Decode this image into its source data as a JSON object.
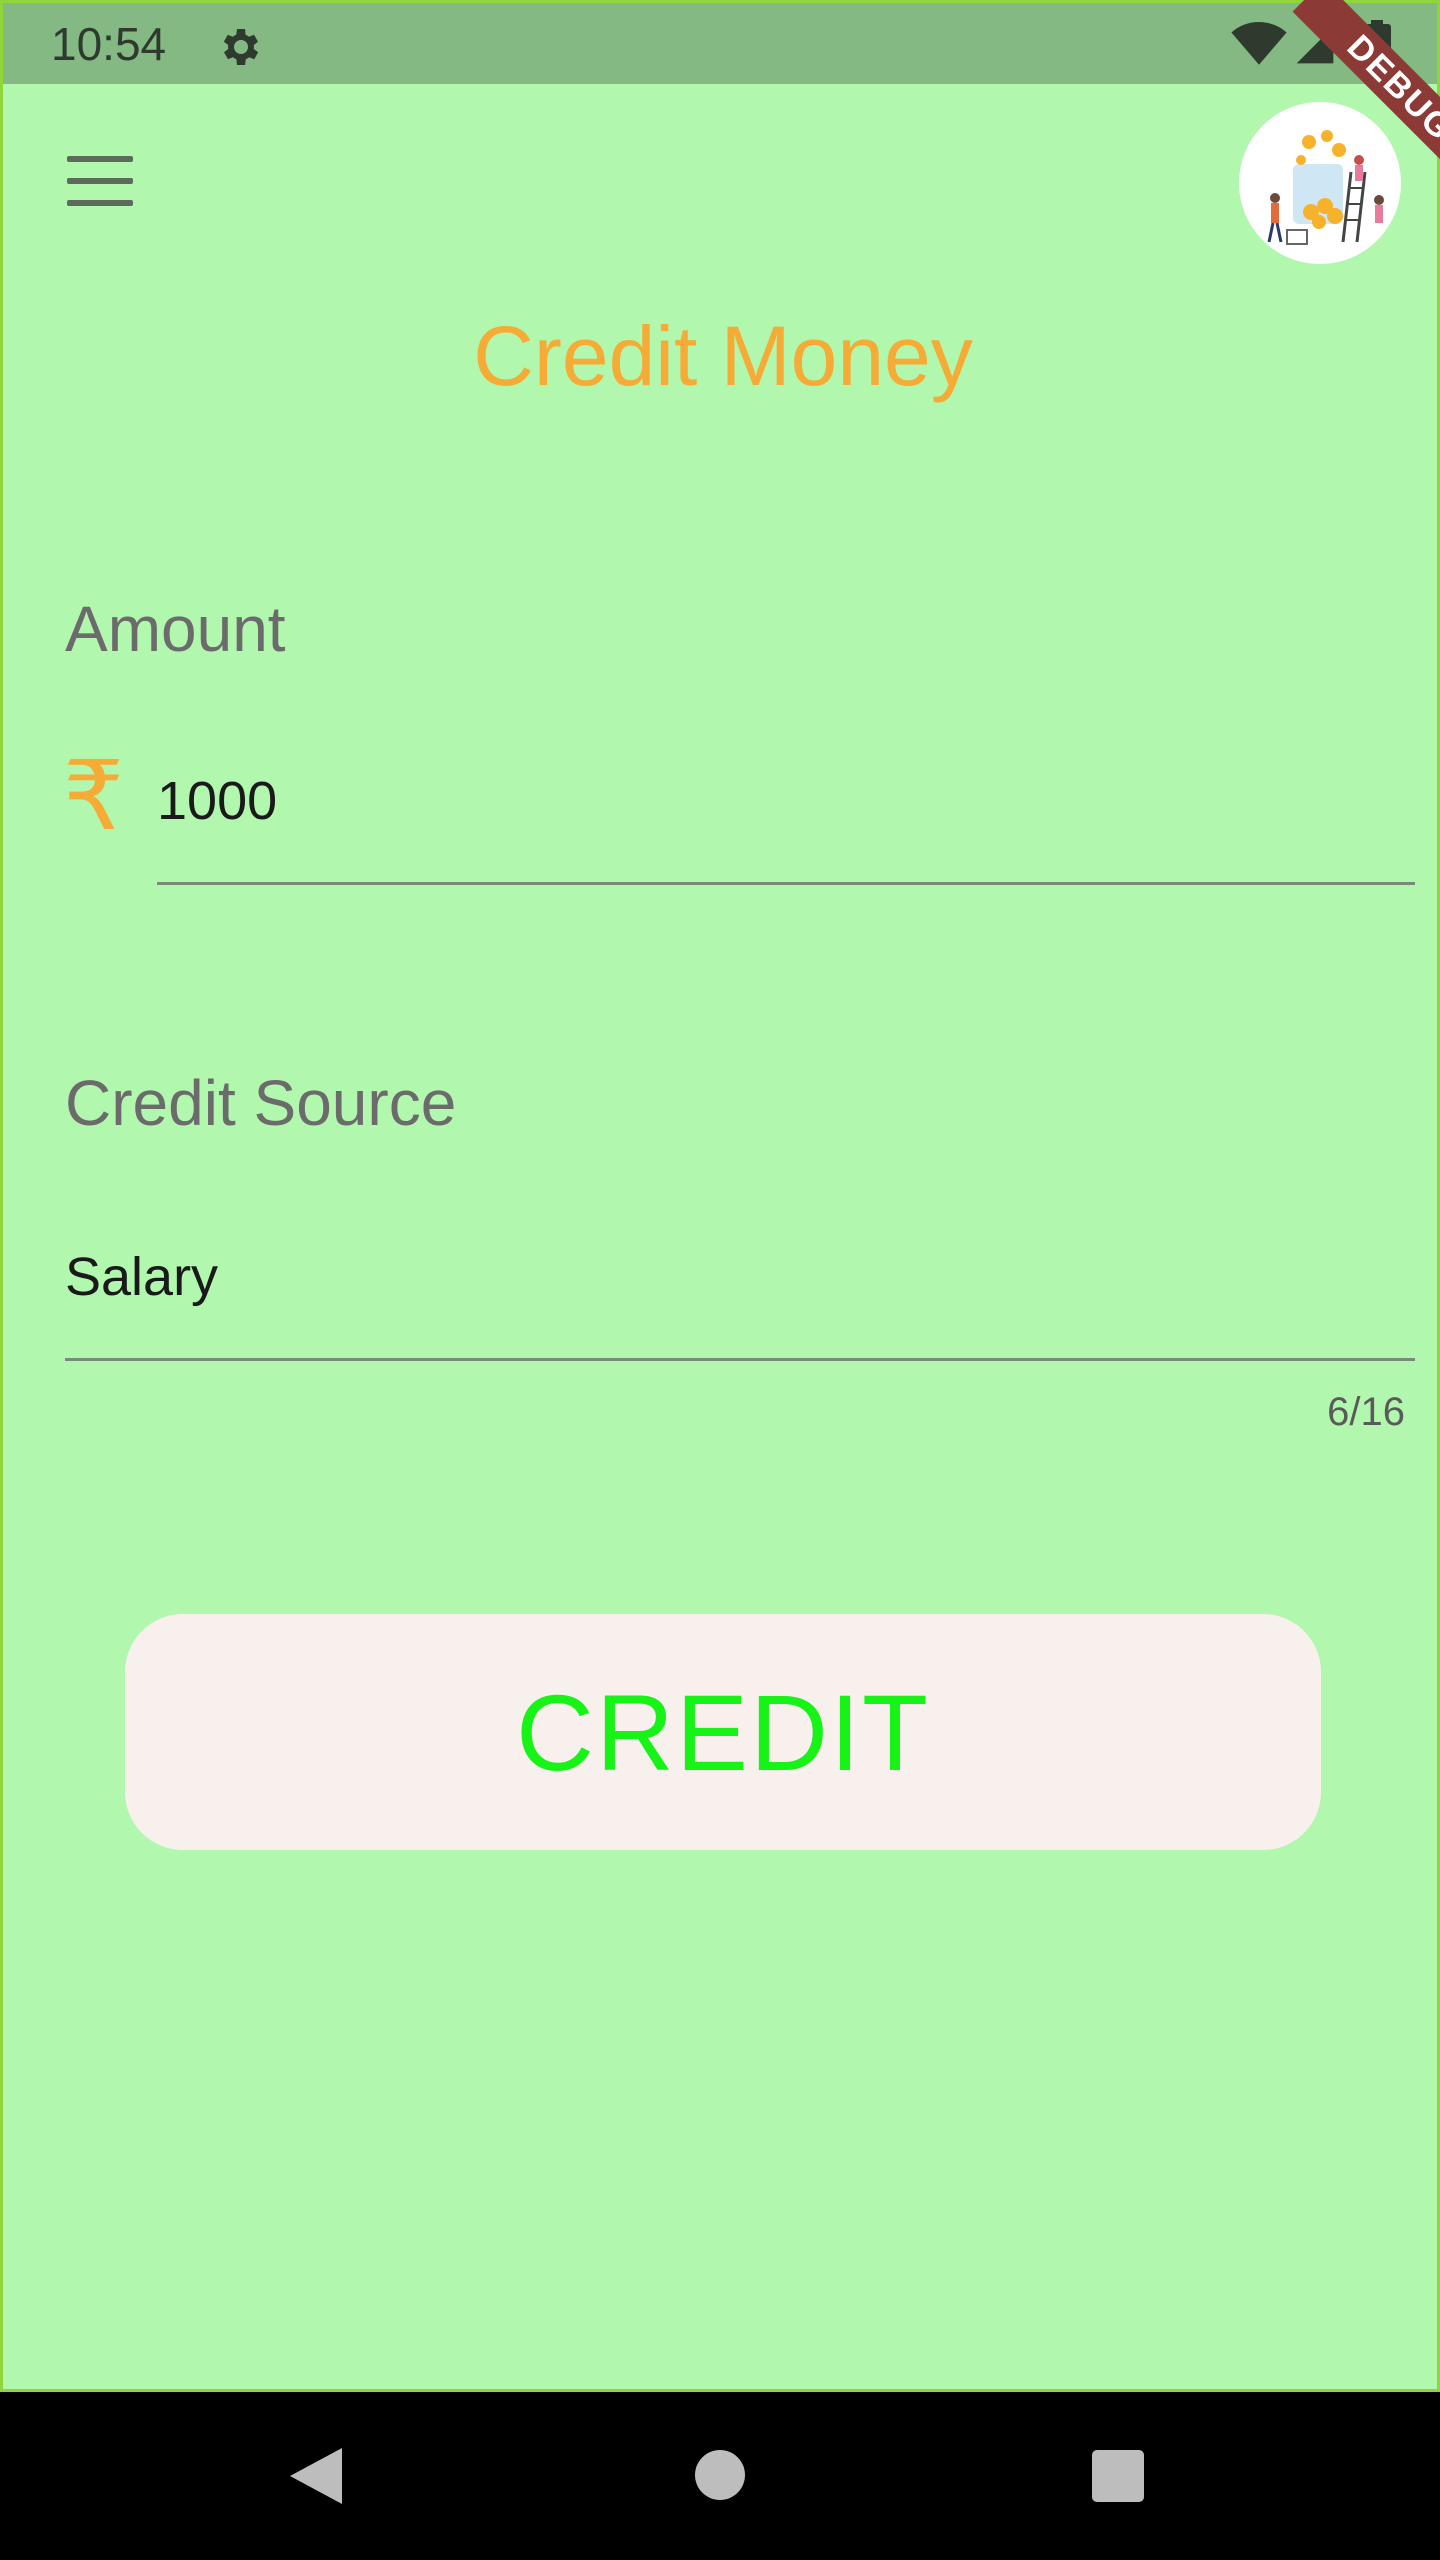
{
  "status_bar": {
    "time": "10:54",
    "icons": [
      "gear-icon",
      "wifi-icon",
      "signal-icon",
      "battery-icon"
    ]
  },
  "debug_banner": "DEBUG",
  "header": {
    "menu_icon": "menu-icon",
    "avatar": "avatar-illustration"
  },
  "page": {
    "title": "Credit Money"
  },
  "amount": {
    "label": "Amount",
    "currency_symbol": "₹",
    "value": "1000"
  },
  "credit_source": {
    "label": "Credit Source",
    "value": "Salary",
    "counter": "6/16"
  },
  "actions": {
    "credit_label": "CREDIT"
  },
  "colors": {
    "background": "#b2f7ae",
    "accent": "#f5ab35",
    "button_text": "#17f217",
    "button_bg": "#f8f0ed"
  },
  "nav_bar": {
    "icons": [
      "back-icon",
      "home-icon",
      "recent-apps-icon"
    ]
  }
}
